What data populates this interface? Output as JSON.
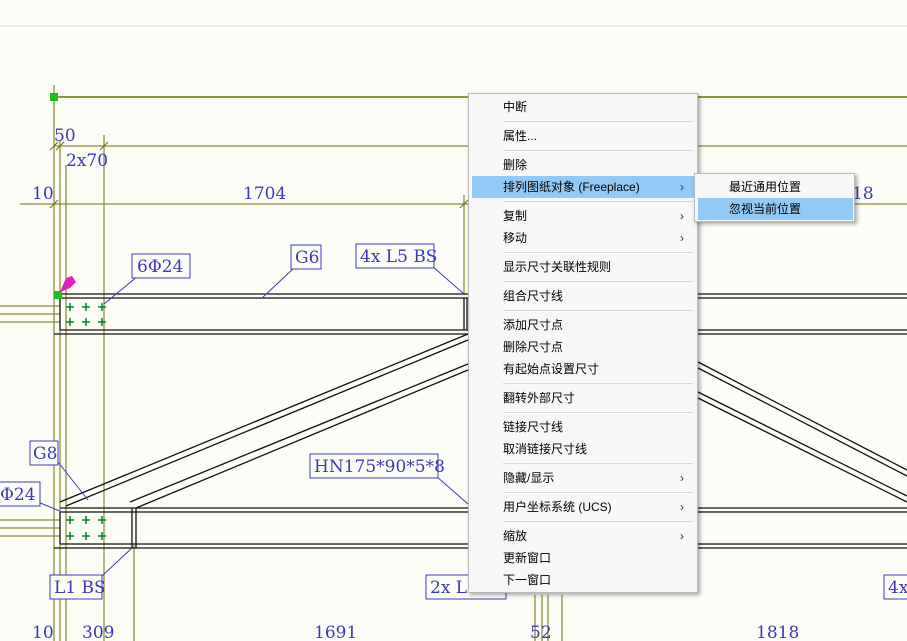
{
  "drawing": {
    "dimensions": [
      "50",
      "2x70",
      "10",
      "1704",
      "18",
      "10",
      "309",
      "1691",
      "52",
      "1818"
    ],
    "labels": [
      "6Φ24",
      "G6",
      "4x L5 BS",
      "G8",
      "HN175*90*5*8",
      "Φ24",
      "L1 BS",
      "2x L",
      "4x"
    ],
    "colors": {
      "line": "#707000",
      "text": "#3a3ab8",
      "bolt": "#00802a",
      "grip": "#20c020",
      "marker": "#e020c0",
      "frame": "#111111"
    }
  },
  "context_menu": {
    "items": [
      {
        "label": "中断"
      },
      {
        "label": "属性..."
      },
      {
        "label": "删除"
      },
      {
        "label": "排列图纸对象 (Freeplace)",
        "submenu": true,
        "highlighted": true
      },
      {
        "label": "复制",
        "submenu": true
      },
      {
        "label": "移动",
        "submenu": true
      },
      {
        "label": "显示尺寸关联性规则"
      },
      {
        "label": "组合尺寸线"
      },
      {
        "label": "添加尺寸点"
      },
      {
        "label": "删除尺寸点"
      },
      {
        "label": "有起始点设置尺寸"
      },
      {
        "label": "翻转外部尺寸"
      },
      {
        "label": "链接尺寸线"
      },
      {
        "label": "取消链接尺寸线"
      },
      {
        "label": "隐藏/显示",
        "submenu": true
      },
      {
        "label": "用户坐标系统 (UCS)",
        "submenu": true
      },
      {
        "label": "缩放",
        "submenu": true
      },
      {
        "label": "更新窗口"
      },
      {
        "label": "下一窗口"
      }
    ],
    "submenu_arrow": "›"
  },
  "sub_menu": {
    "items": [
      {
        "label": "最近通用位置"
      },
      {
        "label": "忽视当前位置",
        "highlighted": true
      }
    ]
  }
}
